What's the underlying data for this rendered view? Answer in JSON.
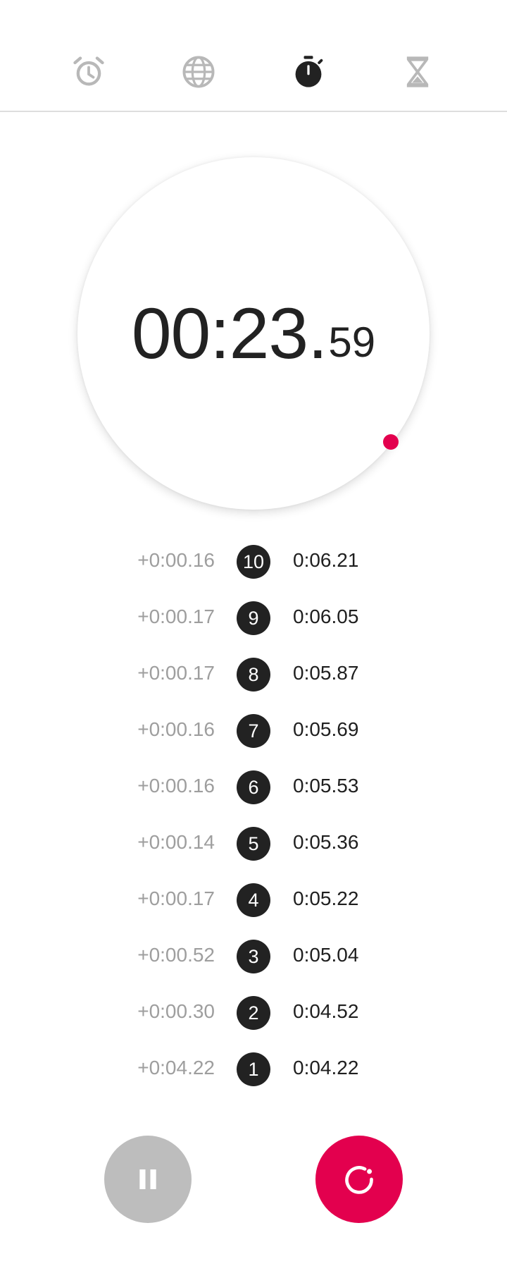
{
  "tabs": [
    {
      "name": "alarm",
      "icon": "alarm-clock-icon",
      "active": false
    },
    {
      "name": "world-clock",
      "icon": "globe-icon",
      "active": false
    },
    {
      "name": "stopwatch",
      "icon": "stopwatch-icon",
      "active": true
    },
    {
      "name": "timer",
      "icon": "hourglass-icon",
      "active": false
    }
  ],
  "stopwatch": {
    "main": "00:23.",
    "hundredths": "59"
  },
  "laps": [
    {
      "diff": "+0:00.16",
      "num": "10",
      "total": "0:06.21"
    },
    {
      "diff": "+0:00.17",
      "num": "9",
      "total": "0:06.05"
    },
    {
      "diff": "+0:00.17",
      "num": "8",
      "total": "0:05.87"
    },
    {
      "diff": "+0:00.16",
      "num": "7",
      "total": "0:05.69"
    },
    {
      "diff": "+0:00.16",
      "num": "6",
      "total": "0:05.53"
    },
    {
      "diff": "+0:00.14",
      "num": "5",
      "total": "0:05.36"
    },
    {
      "diff": "+0:00.17",
      "num": "4",
      "total": "0:05.22"
    },
    {
      "diff": "+0:00.52",
      "num": "3",
      "total": "0:05.04"
    },
    {
      "diff": "+0:00.30",
      "num": "2",
      "total": "0:04.52"
    },
    {
      "diff": "+0:04.22",
      "num": "1",
      "total": "0:04.22"
    }
  ],
  "controls": {
    "pause": {
      "icon": "pause-icon"
    },
    "lap": {
      "icon": "lap-icon"
    }
  },
  "colors": {
    "accent": "#e3004e",
    "active_icon": "#222222",
    "inactive_icon": "#b8b8b8",
    "pause_button": "#bdbdbd",
    "lap_diff_text": "#9e9e9e"
  }
}
